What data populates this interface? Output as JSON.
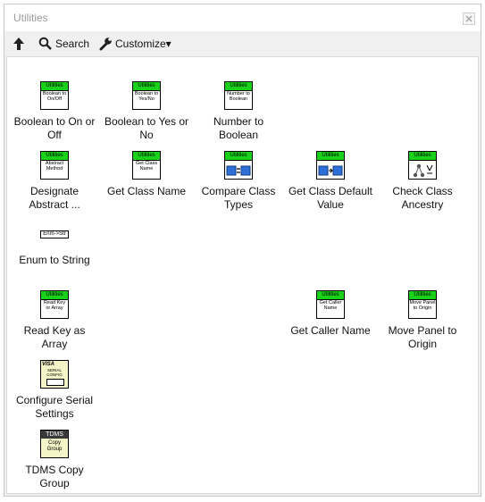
{
  "window": {
    "title": "Utilities"
  },
  "toolbar": {
    "search_label": "Search",
    "customize_label": "Customize▾"
  },
  "items": [
    {
      "label": "Boolean to On or Off",
      "hdr": "Utilities",
      "body": "Boolean to On/Off"
    },
    {
      "label": "Boolean to Yes or No",
      "hdr": "Utilities",
      "body": "Boolean to Yes/No"
    },
    {
      "label": "Number to Boolean",
      "hdr": "Utilities",
      "body": "Number to Boolean"
    },
    {
      "label": "Designate Abstract ...",
      "hdr": "Utilities",
      "body": "Abstract Method"
    },
    {
      "label": "Get Class Name",
      "hdr": "Utilities",
      "body": "Get Class Name"
    },
    {
      "label": "Compare Class Types",
      "hdr": "Utilities",
      "body": ""
    },
    {
      "label": "Get Class Default Value",
      "hdr": "Utilities",
      "body": ""
    },
    {
      "label": "Check Class Ancestry",
      "hdr": "Utilities",
      "body": ""
    },
    {
      "label": "Enum to String",
      "body": "Enm->Str"
    },
    {
      "label": "Read Key as Array",
      "hdr": "Utilities",
      "body": "Read Key or Array"
    },
    {
      "label": "Get Caller Name",
      "hdr": "Utilities",
      "body": "Get Caller Name"
    },
    {
      "label": "Move Panel to Origin",
      "hdr": "Utilities",
      "body": "Move Panel to Origin"
    },
    {
      "label": "Configure Serial Settings",
      "hdr": "VISA",
      "body": "SERIAL CONFIG"
    },
    {
      "label": "TDMS Copy Group",
      "hdr": "TDMS",
      "body": "Copy Group"
    }
  ]
}
